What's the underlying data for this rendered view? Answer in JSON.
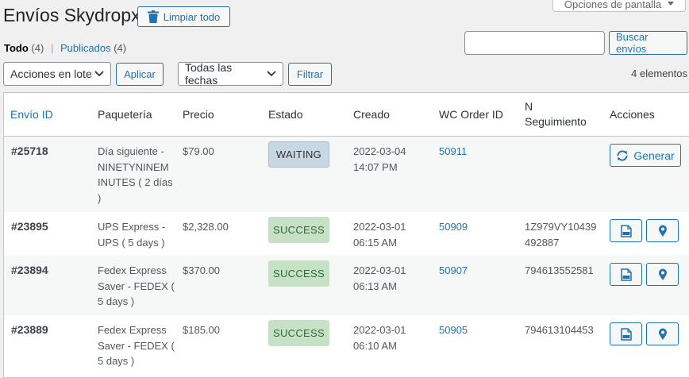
{
  "header": {
    "title": "Envíos Skydropx",
    "clear_label": "Limpiar todo",
    "screen_options_label": "Opciones de pantalla"
  },
  "views": {
    "all_label": "Todo",
    "all_count": "(4)",
    "separator": "|",
    "published_label": "Publicados",
    "published_count": "(4)"
  },
  "search": {
    "placeholder": "",
    "button_label": "Buscar envíos"
  },
  "filters": {
    "bulk_selected": "Acciones en lote",
    "apply_label": "Aplicar",
    "dates_selected": "Todas las fechas",
    "filter_label": "Filtrar",
    "items_count": "4 elementos"
  },
  "table": {
    "columns": {
      "id": "Envío ID",
      "carrier": "Paquetería",
      "price": "Precio",
      "status": "Estado",
      "created": "Creado",
      "order": "WC Order ID",
      "tracking_line1": "N",
      "tracking_line2": "Seguimiento",
      "actions": "Acciones"
    },
    "rows": [
      {
        "id": "#25718",
        "carrier_lines": [
          "Día siguiente -",
          "NINETYNINEM",
          "INUTES ( 2 días",
          ")"
        ],
        "price": "$79.00",
        "status": "WAITING",
        "date": "2022-03-04",
        "time": "14:07 PM",
        "order": "50911",
        "tracking_lines": [],
        "action_label": "Generar"
      },
      {
        "id": "#23895",
        "carrier_lines": [
          "UPS Express -",
          "UPS ( 5 days )"
        ],
        "price": "$2,328.00",
        "status": "SUCCESS",
        "date": "2022-03-01",
        "time": "06:15 AM",
        "order": "50909",
        "tracking_lines": [
          "1Z979VY10439",
          "492887"
        ]
      },
      {
        "id": "#23894",
        "carrier_lines": [
          "Fedex Express",
          "Saver - FEDEX (",
          "5 days )"
        ],
        "price": "$370.00",
        "status": "SUCCESS",
        "date": "2022-03-01",
        "time": "06:13 AM",
        "order": "50907",
        "tracking_lines": [
          "794613552581"
        ]
      },
      {
        "id": "#23889",
        "carrier_lines": [
          "Fedex Express",
          "Saver - FEDEX (",
          "5 days )"
        ],
        "price": "$185.00",
        "status": "SUCCESS",
        "date": "2022-03-01",
        "time": "06:10 AM",
        "order": "50905",
        "tracking_lines": [
          "794613104453"
        ]
      }
    ]
  },
  "icons": {
    "trash": "trash-icon",
    "refresh": "refresh-icon",
    "pdf": "pdf-file-icon",
    "location": "location-pin-icon",
    "chevron": "chevron-down-icon"
  },
  "colors": {
    "accent": "#2271b1",
    "waiting_bg": "#c8d7e1",
    "success_bg": "#c6e1c6",
    "success_text": "#2e6b35"
  }
}
